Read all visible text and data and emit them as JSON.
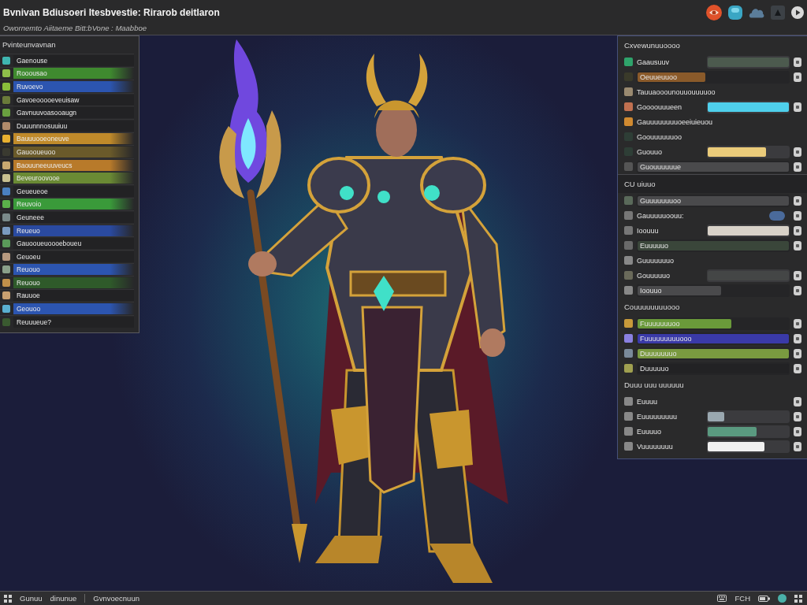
{
  "top_bar": {
    "title": "Bvnivan Bdiusoeri Itesbvestie: Rirarob deitlaron",
    "subtitle": "Owornemto  Aiitaeme Bitt:bVone : Maabboe"
  },
  "left_panel": {
    "title": "Pvinteunvavnan",
    "items": [
      {
        "label": "Gaenouse",
        "color": "#3fb5b0"
      },
      {
        "label": "Rooousao",
        "color": "#8fbf4a",
        "band": {
          "color": "#3f8a2f"
        }
      },
      {
        "label": "Ruvoevo",
        "color": "#8abf3a",
        "band": {
          "color": "#2c55b0"
        }
      },
      {
        "label": "Gavoeooooeveuisaw",
        "color": "#6a7a3a"
      },
      {
        "label": "Gavnuuvoasooaugn",
        "color": "#6aa040"
      },
      {
        "label": "Duuunnnosuuiuu",
        "color": "#b08a6a"
      },
      {
        "label": "Bauuuooeoneuve",
        "color": "#e8b030",
        "band": {
          "color": "#c08a2a"
        }
      },
      {
        "label": "Gauooueuoo",
        "color": "#3a3a30",
        "band": {
          "color": "#6a5a2a"
        }
      },
      {
        "label": "Baouuneeuuveucs",
        "color": "#c8a870",
        "band": {
          "color": "#b87a2a"
        }
      },
      {
        "label": "Beveuroovooe",
        "color": "#c8c090",
        "band": {
          "color": "#6a8a34"
        }
      },
      {
        "label": "Geueueoe",
        "color": "#4a80c0"
      },
      {
        "label": "Reuvoio",
        "color": "#5ab04a",
        "band": {
          "color": "#3a9a3a"
        }
      },
      {
        "label": "Geuneee",
        "color": "#7a8a8a"
      },
      {
        "label": "Reueuo",
        "color": "#7a9ac0",
        "band": {
          "color": "#2a4aa0"
        }
      },
      {
        "label": "Gauooueuoooeboueu",
        "color": "#5a9a5a"
      },
      {
        "label": "Geuoeu",
        "color": "#b89a80"
      },
      {
        "label": "Reuouo",
        "color": "#8aa08a",
        "band": {
          "color": "#2c55b0"
        }
      },
      {
        "label": "Reuouo",
        "color": "#c0904a",
        "band": {
          "color": "#2f5a2a"
        }
      },
      {
        "label": "Rauuoe",
        "color": "#c8a070"
      },
      {
        "label": "Geouoo",
        "color": "#5ab0d0",
        "band": {
          "color": "#2c55b0"
        }
      },
      {
        "label": "Reuuueue?",
        "color": "#3a5a30"
      }
    ]
  },
  "right_panel": {
    "sections": [
      {
        "title": "Cxvewunuuoooo",
        "rows": [
          {
            "kind": "meter",
            "label": "Gaausuuv",
            "color": "#2fa36b",
            "meter": {
              "color": "#4c5a4e",
              "level": 1
            }
          },
          {
            "kind": "band",
            "label": "Oeuueuuoo",
            "color": "#3a3a2a",
            "meter": {
              "color": "#8a5a2a",
              "level": 0.45
            }
          },
          {
            "kind": "text",
            "label": "Tauuaooounouuouuuuoo",
            "color": "#9a8a70"
          },
          {
            "kind": "meter",
            "label": "Goooouuueen",
            "color": "#c07050",
            "meter": {
              "color": "#4fd0ec",
              "level": 1
            }
          },
          {
            "kind": "text",
            "label": "Gauuuuuuuuoeeiuieuou",
            "color": "#d08a30"
          },
          {
            "kind": "text",
            "label": "Goouuuuuuoo",
            "color": "#2e3e36"
          },
          {
            "kind": "meter",
            "label": "Guouuo",
            "color": "#2e3e36",
            "meter": {
              "color": "#eacb7a",
              "level": 0.72
            }
          },
          {
            "kind": "band",
            "label": "Guouuuuuue",
            "color": "#555555",
            "meter": {
              "color": "#4a4a4c",
              "level": 1
            }
          }
        ]
      },
      {
        "title": "CU uiuuo",
        "rows": [
          {
            "kind": "band",
            "label": "Guuuuuuuoo",
            "color": "#5a6a5a",
            "meter": {
              "color": "#4a4a4c",
              "level": 1
            }
          },
          {
            "kind": "badge",
            "label": "Gauuuuuoouu:",
            "color": "#777777"
          },
          {
            "kind": "meter",
            "label": "Ioouuu",
            "color": "#777777",
            "meter": {
              "color": "#d8d2c8",
              "level": 1
            }
          },
          {
            "kind": "band",
            "label": "Euuuuuo",
            "color": "#6a6a6a",
            "meter": {
              "color": "#3a463a",
              "level": 1
            }
          },
          {
            "kind": "text",
            "label": "Guuuuuuuo",
            "color": "#888888"
          },
          {
            "kind": "meter",
            "label": "Gouuuuuo",
            "color": "#6a6a5a",
            "meter": {
              "color": "#444646",
              "level": 1
            }
          },
          {
            "kind": "band",
            "label": "Ioouuo",
            "color": "#888888",
            "meter": {
              "color": "#4a4a4c",
              "level": 0.55
            }
          }
        ]
      },
      {
        "title": "Couuuuuuuuooo",
        "rows": [
          {
            "kind": "band",
            "label": "Fuuuuuuuoo",
            "color": "#c89a3a",
            "meter": {
              "color": "#6a9a3a",
              "level": 0.62
            }
          },
          {
            "kind": "band",
            "label": "Fuuuuuuuuuooo",
            "color": "#8a80e0",
            "meter": {
              "color": "#3a3aa8",
              "level": 1
            }
          },
          {
            "kind": "band",
            "label": "Duuuuuuuo",
            "color": "#7a8a9a",
            "meter": {
              "color": "#7a9a40",
              "level": 1
            }
          },
          {
            "kind": "band",
            "label": "Duuuuuo",
            "color": "#a0a050",
            "meter": {
              "color": "#222224",
              "level": 1
            }
          }
        ]
      },
      {
        "title": "Duuu uuu uuuuuu",
        "rows": [
          {
            "kind": "knob",
            "label": "Euuuu",
            "color": "#888888"
          },
          {
            "kind": "meter",
            "label": "Euuuuuuuuu",
            "color": "#888888",
            "meter": {
              "color": "#9aa8b0",
              "level": 0.2
            }
          },
          {
            "kind": "meter",
            "label": "Euuuuo",
            "color": "#888888",
            "meter": {
              "color": "#5a9a80",
              "level": 0.6
            }
          },
          {
            "kind": "meter",
            "label": "Vuuuuuuuu",
            "color": "#888888",
            "meter": {
              "color": "#f0f0f0",
              "level": 0.7
            }
          }
        ]
      }
    ]
  },
  "status_bar": {
    "items": [
      "Gunuu",
      "dinunue",
      "Gvnvoecnuun"
    ],
    "indicator": "FCH"
  }
}
